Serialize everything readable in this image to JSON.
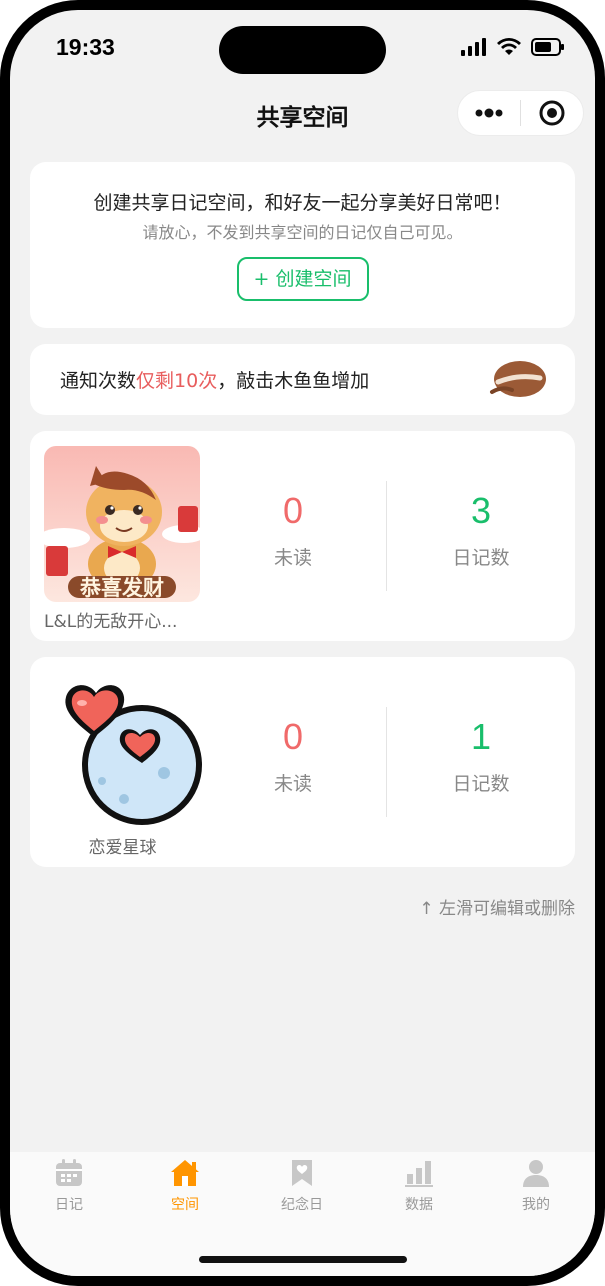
{
  "status_bar": {
    "time": "19:33"
  },
  "nav": {
    "title": "共享空间"
  },
  "create_card": {
    "title": "创建共享日记空间，和好友一起分享美好日常吧！",
    "subtitle": "请放心，不发到共享空间的日记仅自己可见。",
    "button_label": "+ 创建空间"
  },
  "notice": {
    "prefix": "通知次数",
    "highlight": "仅剩10次",
    "suffix": "，敲击木鱼鱼增加"
  },
  "spaces": [
    {
      "name": "L&L的无敌开心...",
      "cover_text": "恭喜发财",
      "unread": "0",
      "unread_label": "未读",
      "diary_count": "3",
      "diary_label": "日记数"
    },
    {
      "name": "恋爱星球",
      "unread": "0",
      "unread_label": "未读",
      "diary_count": "1",
      "diary_label": "日记数"
    }
  ],
  "hint": "↑ 左滑可编辑或删除",
  "tabs": [
    {
      "label": "日记",
      "icon": "calendar-icon"
    },
    {
      "label": "空间",
      "icon": "house-icon",
      "active": true
    },
    {
      "label": "纪念日",
      "icon": "bookmark-heart-icon"
    },
    {
      "label": "数据",
      "icon": "bar-chart-icon"
    },
    {
      "label": "我的",
      "icon": "person-icon"
    }
  ],
  "colors": {
    "accent_green": "#19be6b",
    "accent_red": "#f06a6a",
    "tab_active": "#ff9500"
  }
}
